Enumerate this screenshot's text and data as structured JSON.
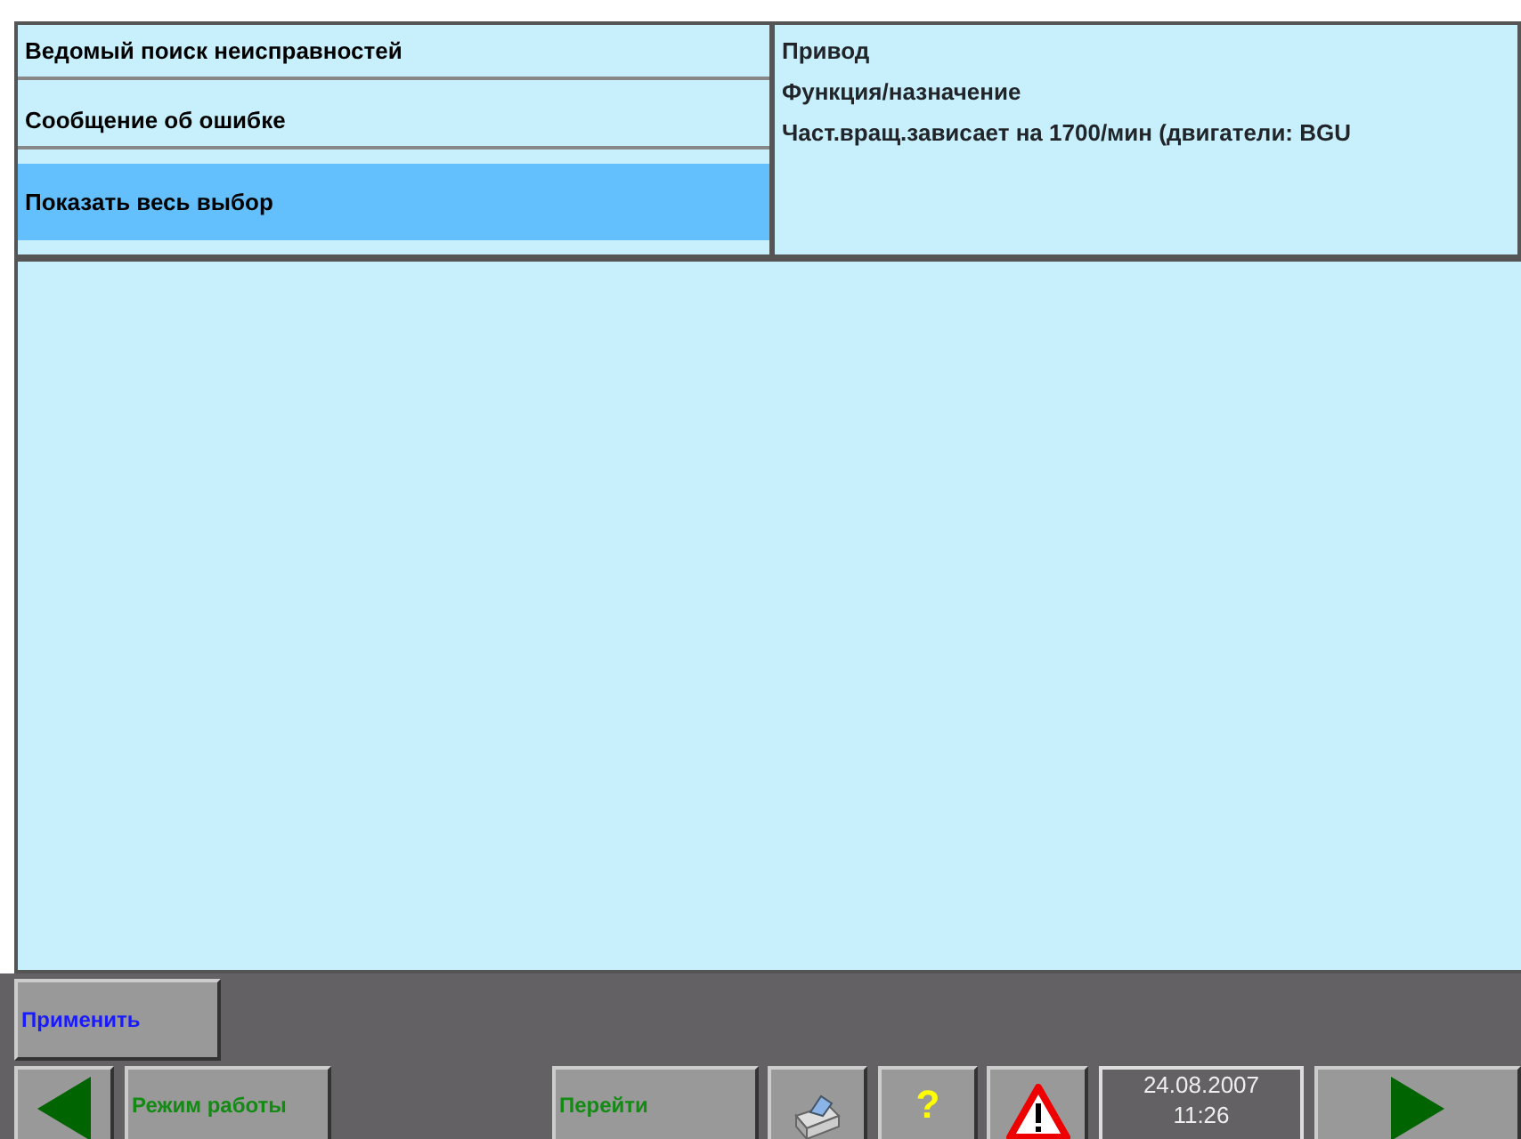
{
  "menu": [
    {
      "label": "Ведомый поиск неисправностей",
      "selected": false
    },
    {
      "label": "Сообщение об ошибке",
      "selected": false
    },
    {
      "label": "Показать весь выбор",
      "selected": true
    }
  ],
  "info": [
    "Привод",
    "Функция/назначение",
    "Част.вращ.зависает на 1700/мин (двигатели: BGU"
  ],
  "apply_button": "Применить",
  "toolbar": {
    "mode_button": "Режим работы",
    "goto_button": "Перейти",
    "help_button": "?",
    "date": "24.08.2007",
    "time": "11:26"
  }
}
